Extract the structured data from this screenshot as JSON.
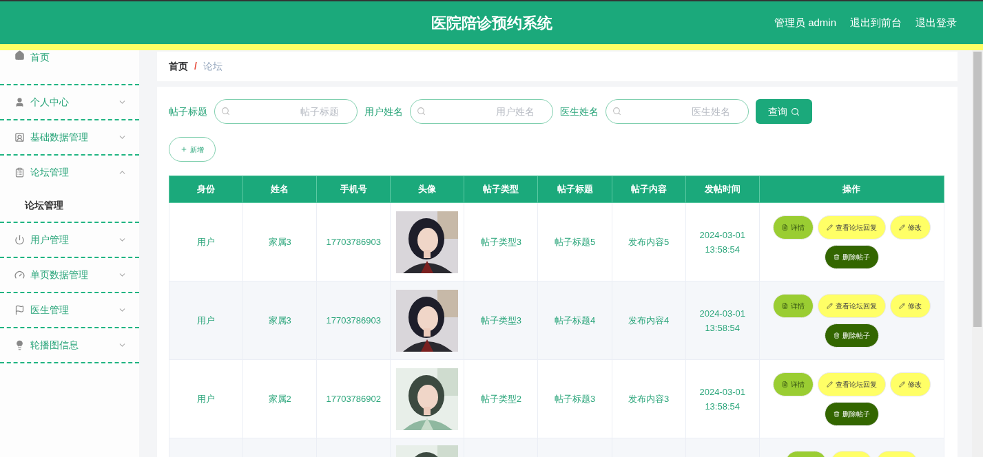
{
  "header": {
    "title": "医院陪诊预约系统",
    "links": [
      {
        "label": "管理员 admin"
      },
      {
        "label": "退出到前台"
      },
      {
        "label": "退出登录"
      }
    ]
  },
  "sidebar": {
    "items": [
      {
        "label": "首页"
      },
      {
        "label": "个人中心",
        "expanded": false
      },
      {
        "label": "基础数据管理",
        "expanded": false
      },
      {
        "label": "论坛管理",
        "expanded": true,
        "children": [
          {
            "label": "论坛管理"
          }
        ]
      },
      {
        "label": "用户管理",
        "expanded": false
      },
      {
        "label": "单页数据管理",
        "expanded": false
      },
      {
        "label": "医生管理",
        "expanded": false
      },
      {
        "label": "轮播图信息",
        "expanded": false
      }
    ]
  },
  "breadcrumb": {
    "separator": "/",
    "items": [
      {
        "label": "首页"
      },
      {
        "label": "论坛"
      }
    ]
  },
  "search": {
    "fields": [
      {
        "label": "帖子标题",
        "placeholder": "帖子标题"
      },
      {
        "label": "用户姓名",
        "placeholder": "用户姓名"
      },
      {
        "label": "医生姓名",
        "placeholder": "医生姓名"
      }
    ],
    "button": "查询"
  },
  "add_button": "新增",
  "table": {
    "columns": [
      "身份",
      "姓名",
      "手机号",
      "头像",
      "帖子类型",
      "帖子标题",
      "帖子内容",
      "发帖时间",
      "操作"
    ],
    "rows": [
      {
        "cells": [
          "用户",
          "家属3",
          "17703786903",
          "帖子类型3",
          "帖子标题5",
          "发布内容5",
          "2024-03-01 13:58:54"
        ],
        "avatar": {
          "kind": "picture"
        },
        "actions": [
          {
            "kind": "detail",
            "label": "详情"
          },
          {
            "kind": "reply",
            "label": "查看论坛回复"
          },
          {
            "kind": "edit",
            "label": "修改"
          },
          {
            "kind": "delete",
            "label": "删除帖子"
          }
        ]
      },
      {
        "cells": [
          "用户",
          "家属3",
          "17703786903",
          "帖子类型3",
          "帖子标题4",
          "发布内容4",
          "2024-03-01 13:58:54"
        ],
        "avatar": {
          "kind": "picture"
        },
        "actions": [
          {
            "kind": "detail",
            "label": "详情"
          },
          {
            "kind": "reply",
            "label": "查看论坛回复"
          },
          {
            "kind": "edit",
            "label": "修改"
          },
          {
            "kind": "delete",
            "label": "删除帖子"
          }
        ]
      },
      {
        "cells": [
          "用户",
          "家属2",
          "17703786902",
          "帖子类型2",
          "帖子标题3",
          "发布内容3",
          "2024-03-01 13:58:54"
        ],
        "avatar": {
          "kind": "picture"
        },
        "actions": [
          {
            "kind": "detail",
            "label": "详情"
          },
          {
            "kind": "reply",
            "label": "查看论坛回复"
          },
          {
            "kind": "edit",
            "label": "修改"
          },
          {
            "kind": "delete",
            "label": "删除帖子"
          }
        ]
      },
      {
        "avatar": {
          "kind": "picture"
        },
        "actions": [
          {
            "kind": "detail"
          },
          {
            "kind": "reply"
          },
          {
            "kind": "edit"
          }
        ]
      }
    ]
  }
}
